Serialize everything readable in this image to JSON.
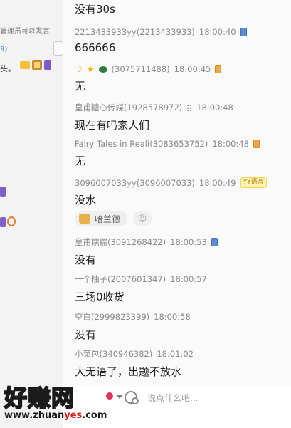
{
  "sidebar": {
    "top_text": "管理员可以发言",
    "count": "9)",
    "head_text": "头。"
  },
  "messages": [
    {
      "text": "没有30s"
    },
    {
      "nick": "2213433933yy(2213433933)",
      "time": "18:00:40",
      "device": "phone-blue",
      "text": "666666"
    },
    {
      "nick": "(3075711488)",
      "time": "18:00:45",
      "device": "phone-orange",
      "text": "无"
    },
    {
      "nick": "皇甫糖心传媒(1928578972)",
      "time": "18:00:48",
      "text": "现在有吗家人们"
    },
    {
      "nick": "Fairy Tales in Reali(3083653752)",
      "time": "18:00:48",
      "device": "phone-orange",
      "text": "无"
    },
    {
      "nick": "3096007033yy(3096007033)",
      "time": "18:00:49",
      "badge": "YY语音",
      "text": "没水"
    },
    {
      "nick": "皇甫糯糯(3091268422)",
      "time": "18:00:53",
      "device": "phone-blue",
      "text": "没有"
    },
    {
      "nick": "一个柚子(2007601347)",
      "time": "18:00:57",
      "text": "三场0收货"
    },
    {
      "nick": "空白(2999823399)",
      "time": "18:00:58",
      "text": "没有"
    },
    {
      "nick": "小菜包(340946382)",
      "time": "18:01:02",
      "text": "大无语了，出题不放水"
    }
  ],
  "reaction": {
    "label": "哈兰德"
  },
  "input": {
    "placeholder": "说点什么吧..."
  },
  "watermark": {
    "big": "好赚网",
    "url_pre": "www.zhuan",
    "url_hl": "yes",
    "url_post": ".com"
  },
  "colors": {
    "accent_blue": "#3f7fd1",
    "yy_yellow": "#fff3b8",
    "mic_red": "#e3325d"
  }
}
